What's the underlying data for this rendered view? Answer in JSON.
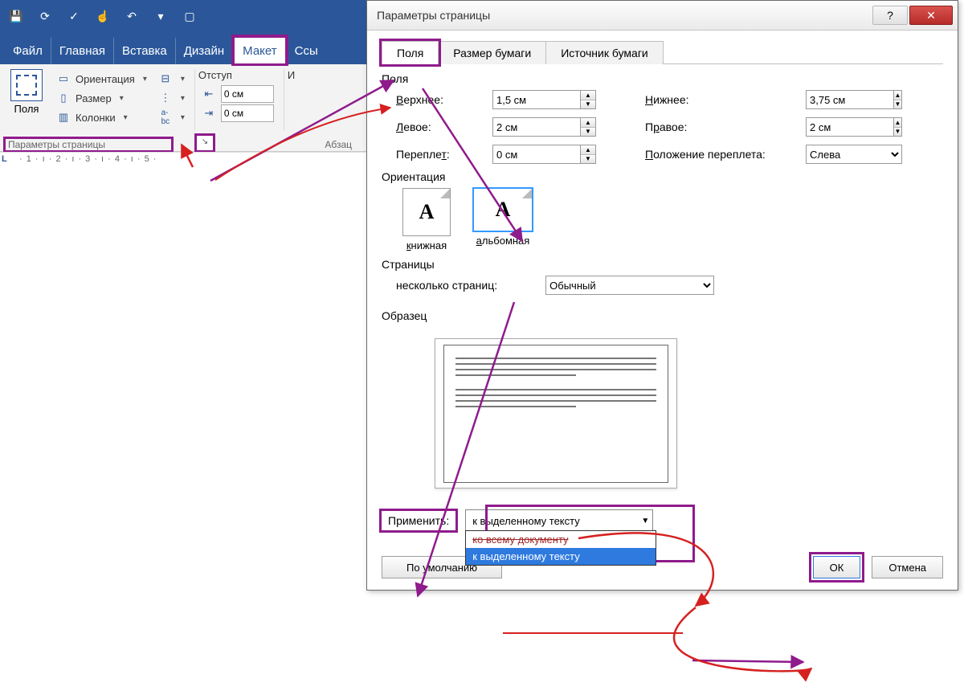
{
  "qat_icons": [
    "save",
    "refresh",
    "spellcheck",
    "touch",
    "undo",
    "redo-menu",
    "new-doc"
  ],
  "tabs": {
    "file": "Файл",
    "home": "Главная",
    "insert": "Вставка",
    "design": "Дизайн",
    "layout": "Макет",
    "refs": "Ссы"
  },
  "ribbon": {
    "margins": "Поля",
    "orientation": "Ориентация",
    "size": "Размер",
    "columns": "Колонки",
    "indent_label": "Отступ",
    "indent_value": "0 см",
    "group_title": "Параметры страницы",
    "group2_title": "Абзац"
  },
  "ruler_text": " · 1 · ı · 2 · ı · 3 · ı · 4 · ı · 5 ·",
  "ruler_marker": "L",
  "dialog": {
    "title": "Параметры страницы",
    "tab_fields": "Поля",
    "tab_paper": "Размер бумаги",
    "tab_source": "Источник бумаги",
    "sec_fields": "Поля",
    "top_l": "Верхнее:",
    "top_v": "1,5 см",
    "bottom_l": "Нижнее:",
    "bottom_v": "3,75 см",
    "left_l": "Левое:",
    "left_v": "2 см",
    "right_l": "Правое:",
    "right_v": "2 см",
    "gut_l": "Переплет:",
    "gut_v": "0 см",
    "gutpos_l": "Положение переплета:",
    "gutpos_v": "Слева",
    "sec_orient": "Ориентация",
    "orient_port": "книжная",
    "orient_land": "альбомная",
    "sec_pages": "Страницы",
    "multi_l": "несколько страниц:",
    "multi_v": "Обычный",
    "sec_preview": "Образец",
    "apply_l": "Применить:",
    "apply_v": "к выделенному тексту",
    "apply_opt_all": "ко всему документу",
    "apply_opt_sel": "к выделенному тексту",
    "defaults": "По умолчанию",
    "ok": "ОК",
    "cancel": "Отмена",
    "help": "?",
    "close": "✕"
  }
}
